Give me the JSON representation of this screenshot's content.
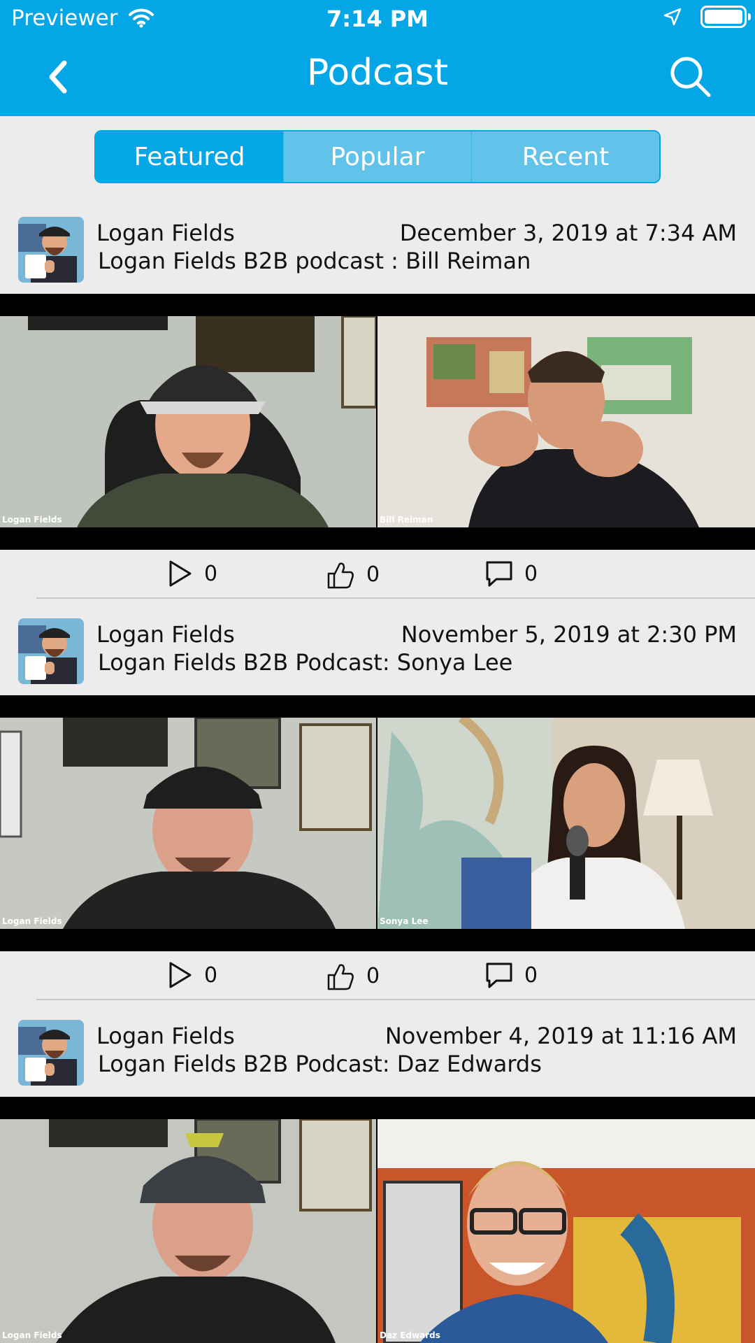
{
  "status_bar": {
    "carrier": "Previewer",
    "time": "7:14 PM"
  },
  "nav": {
    "title": "Podcast",
    "back_icon": "chevron-left-icon",
    "search_icon": "search-icon"
  },
  "tabs": [
    {
      "label": "Featured",
      "active": true
    },
    {
      "label": "Popular",
      "active": false
    },
    {
      "label": "Recent",
      "active": false
    }
  ],
  "colors": {
    "brand": "#05a6e6",
    "tab_inactive": "#61c3ea",
    "background": "#ececec"
  },
  "posts": [
    {
      "author": "Logan Fields",
      "date": "December 3, 2019 at 7:34 AM",
      "title": "Logan Fields B2B podcast : Bill Reiman",
      "video_labels": [
        "Logan Fields",
        "Bill Reiman"
      ],
      "plays": "0",
      "likes": "0",
      "comments": "0"
    },
    {
      "author": "Logan Fields",
      "date": "November 5, 2019 at 2:30 PM",
      "title": "Logan Fields B2B Podcast: Sonya Lee",
      "video_labels": [
        "Logan Fields",
        "Sonya Lee"
      ],
      "plays": "0",
      "likes": "0",
      "comments": "0"
    },
    {
      "author": "Logan Fields",
      "date": "November 4, 2019 at 11:16 AM",
      "title": "Logan Fields B2B Podcast: Daz Edwards",
      "video_labels": [
        "Logan Fields",
        "Daz Edwards"
      ]
    }
  ]
}
